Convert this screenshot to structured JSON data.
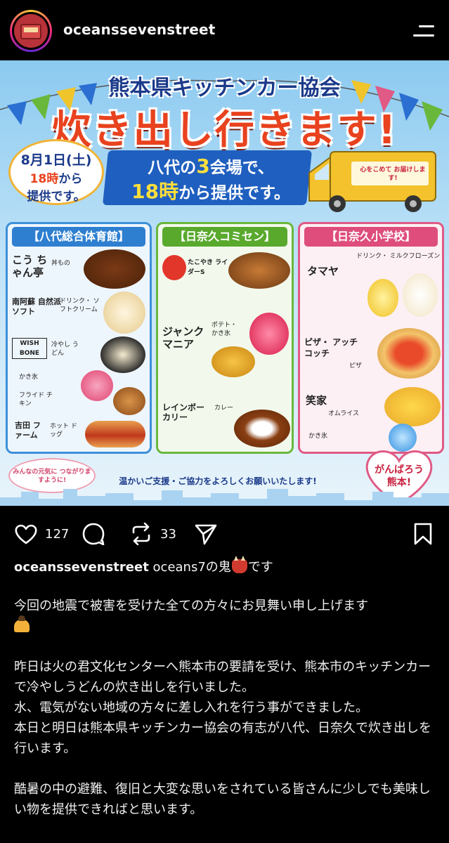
{
  "header": {
    "username": "oceanssevenstreet",
    "avatar_icon": "red-bus-avatar",
    "menu_icon": "menu-icon"
  },
  "poster": {
    "org_title": "熊本県キッチンカー協会",
    "main_title": "炊き出し行きます!",
    "date_line1": "8月1日(土)",
    "date_time": "18時",
    "date_from": "から",
    "date_line3": "提供です。",
    "venue_line1_pre": "八代の",
    "venue_line1_num": "3",
    "venue_line1_post": "会場で、",
    "venue_line2_hl": "18時",
    "venue_line2_post": "から提供です。",
    "truck_sign": "心をこめて お届けします!",
    "columns": [
      {
        "title": "【八代総合体育館】",
        "items": [
          {
            "vendor": "こう ちゃん亭",
            "menu": "丼もの"
          },
          {
            "vendor": "南阿蘇 自然派ソフト",
            "menu": "ドリンク・ ソフトクリーム"
          },
          {
            "vendor": "WISH BONE",
            "menu": "冷やし うどん"
          },
          {
            "vendor": "",
            "menu": "かき氷"
          },
          {
            "vendor": "",
            "menu": "フライド チキン"
          },
          {
            "vendor": "吉田 ファーム",
            "menu": "ホット ドッグ"
          }
        ]
      },
      {
        "title": "【日奈久コミセン】",
        "items": [
          {
            "vendor": "たこやき ライダーS",
            "menu": ""
          },
          {
            "vendor": "ジャンク マニア",
            "menu": "ポテト・ かき氷"
          },
          {
            "vendor": "レインボー カリー",
            "menu": "カレー"
          }
        ]
      },
      {
        "title": "【日奈久小学校】",
        "items": [
          {
            "vendor": "タマヤ",
            "menu": "ドリンク・ ミルクフローズン"
          },
          {
            "vendor": "ピザ・ アッチコッチ",
            "menu": "ピザ"
          },
          {
            "vendor": "笑家",
            "menu": "オムライス"
          },
          {
            "vendor": "",
            "menu": "かき氷"
          }
        ]
      }
    ],
    "cheer": "みんなの元気に つながりますように!",
    "support": "温かいご支援・ご協力をよろしくお願いいたします!",
    "heart_text": "がんばろう 熊本!"
  },
  "actions": {
    "likes": "127",
    "reposts": "33"
  },
  "caption": {
    "username": "oceanssevenstreet",
    "intro": "oceans7の鬼",
    "intro_end": "です",
    "p1": "今回の地震で被害を受けた全ての方々にお見舞い申し上げます",
    "p2_l1": "昨日は火の君文化センターへ熊本市の要請を受け、熊本市のキッチンカーで冷やしうどんの炊き出しを行いました。",
    "p2_l2": "水、電気がない地域の方々に差し入れを行う事ができました。",
    "p2_l3": "本日と明日は熊本県キッチンカー協会の有志が八代、日奈久で炊き出しを行います。",
    "p3": "酷暑の中の避難、復旧と大変な思いをされている皆さんに少しでも美味しい物を提供できればと思います。"
  }
}
